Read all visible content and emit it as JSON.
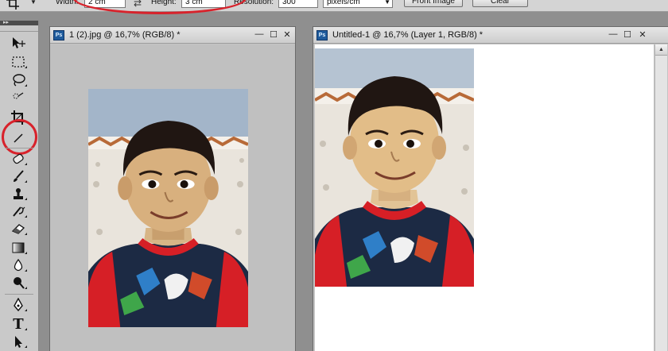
{
  "options_bar": {
    "width_label": "Width:",
    "width_value": "2 cm",
    "swap_icon": "swap-arrows-icon",
    "height_label": "Height:",
    "height_value": "3 cm",
    "resolution_label": "Resolution:",
    "resolution_value": "300",
    "units_value": "pixels/cm",
    "front_image_label": "Front Image",
    "clear_label": "Clear",
    "highlight_color": "#d8222b"
  },
  "toolbox": {
    "tools": [
      "move-tool-icon",
      "marquee-tool-icon",
      "lasso-tool-icon",
      "quick-selection-tool-icon",
      "crop-tool-icon",
      "slice-tool-icon",
      "healing-brush-tool-icon",
      "brush-tool-icon",
      "clone-stamp-tool-icon",
      "history-brush-tool-icon",
      "eraser-tool-icon",
      "gradient-tool-icon",
      "blur-tool-icon",
      "dodge-tool-icon",
      "pen-tool-icon",
      "type-tool-icon",
      "path-selection-tool-icon"
    ],
    "type_glyph": "T",
    "active_tool": "crop-tool-icon"
  },
  "windows": [
    {
      "ps_icon_label": "Ps",
      "title": "1 (2).jpg @ 16,7% (RGB/8) *",
      "minimize": "—",
      "maximize": "☐",
      "close": "✕"
    },
    {
      "ps_icon_label": "Ps",
      "title": "Untitled-1 @ 16,7% (Layer 1, RGB/8) *",
      "minimize": "—",
      "maximize": "☐",
      "close": "✕"
    }
  ],
  "colors": {
    "shirt": "#1c2a44",
    "collar": "#d61f26",
    "wall": "#e9e4dc",
    "tile_border": "#b86a38"
  }
}
